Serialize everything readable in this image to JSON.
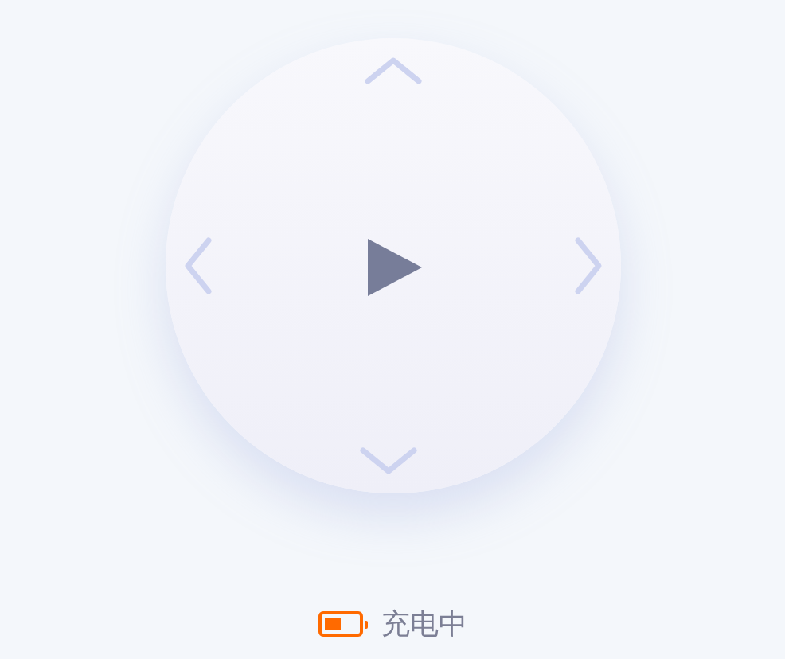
{
  "battery": {
    "label": "充电中"
  }
}
